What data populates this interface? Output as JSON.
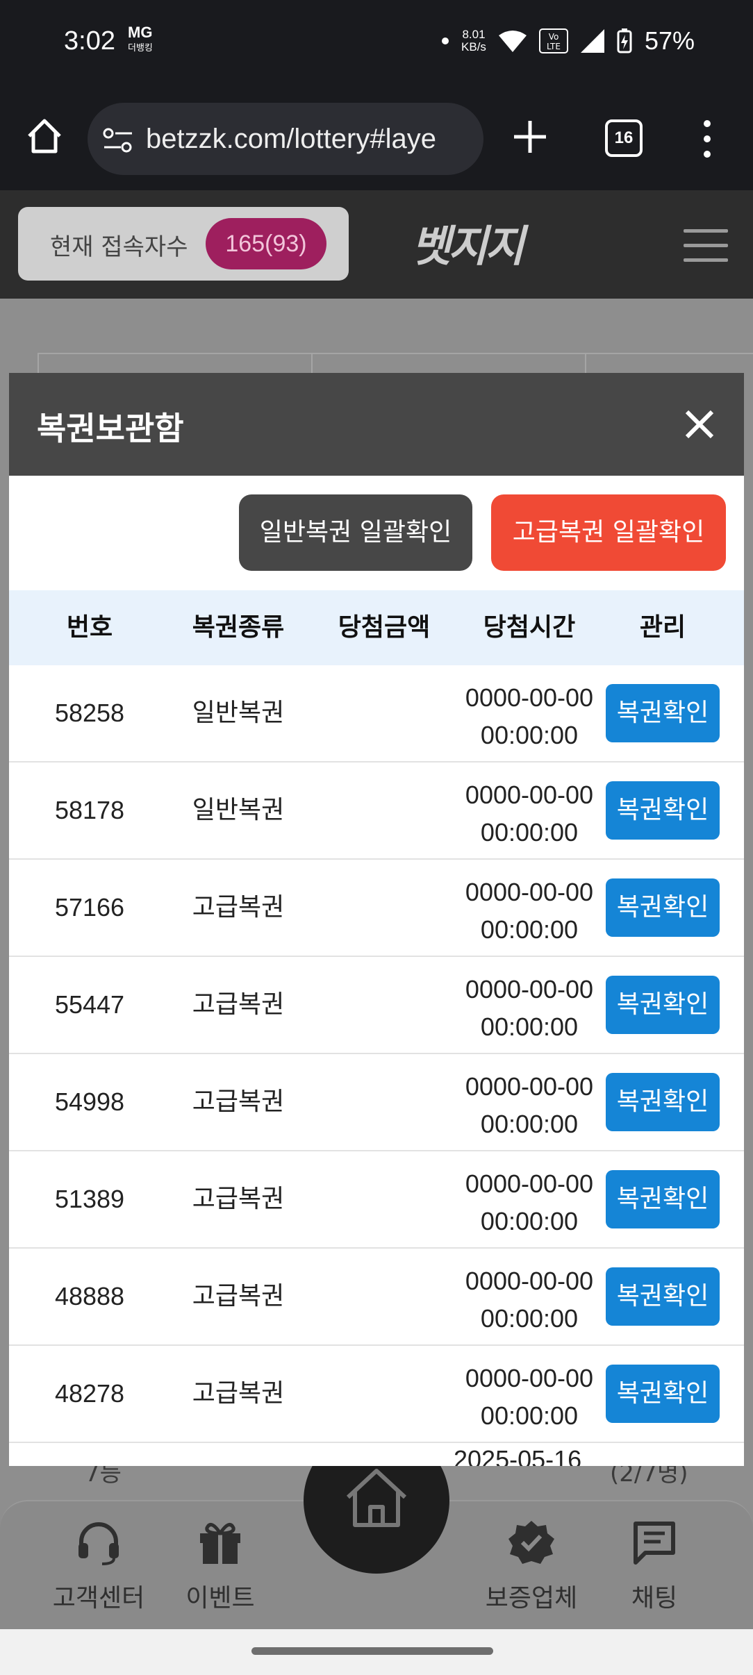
{
  "status_bar": {
    "time": "3:02",
    "carrier": "MG",
    "carrier_sub": "더뱅킹",
    "net_speed": "8.01",
    "net_unit": "KB/s",
    "volte": "Vo LTE",
    "battery": "57%"
  },
  "browser": {
    "url": "betzzk.com/lottery#laye",
    "tab_count": "16"
  },
  "site_header": {
    "connected_label": "현재 접속자수",
    "connected_count": "165(93)",
    "logo_text": "벳지지"
  },
  "modal": {
    "title": "복권보관함",
    "btn_normal_confirm": "일반복권 일괄확인",
    "btn_premium_confirm": "고급복권 일괄확인",
    "columns": [
      "번호",
      "복권종류",
      "당첨금액",
      "당첨시간",
      "관리"
    ],
    "action_label": "복권확인",
    "rows": [
      {
        "no": "58258",
        "type": "일반복권",
        "amount": "",
        "date": "0000-00-00",
        "time": "00:00:00"
      },
      {
        "no": "58178",
        "type": "일반복권",
        "amount": "",
        "date": "0000-00-00",
        "time": "00:00:00"
      },
      {
        "no": "57166",
        "type": "고급복권",
        "amount": "",
        "date": "0000-00-00",
        "time": "00:00:00"
      },
      {
        "no": "55447",
        "type": "고급복권",
        "amount": "",
        "date": "0000-00-00",
        "time": "00:00:00"
      },
      {
        "no": "54998",
        "type": "고급복권",
        "amount": "",
        "date": "0000-00-00",
        "time": "00:00:00"
      },
      {
        "no": "51389",
        "type": "고급복권",
        "amount": "",
        "date": "0000-00-00",
        "time": "00:00:00"
      },
      {
        "no": "48888",
        "type": "고급복권",
        "amount": "",
        "date": "0000-00-00",
        "time": "00:00:00"
      },
      {
        "no": "48278",
        "type": "고급복권",
        "amount": "",
        "date": "0000-00-00",
        "time": "00:00:00"
      }
    ],
    "partial_row_date": "2025-05-16"
  },
  "background_page": {
    "row_rank": "7등",
    "row_count": "(2/7명)"
  },
  "bottom_nav": {
    "customer_center": "고객센터",
    "event": "이벤트",
    "verified": "보증업체",
    "chat": "채팅"
  },
  "colors": {
    "modal_header": "#474747",
    "premium_button": "#f04a35",
    "check_button": "#1585d6",
    "table_header": "#e8f2fc",
    "badge": "#9e1f5e"
  }
}
